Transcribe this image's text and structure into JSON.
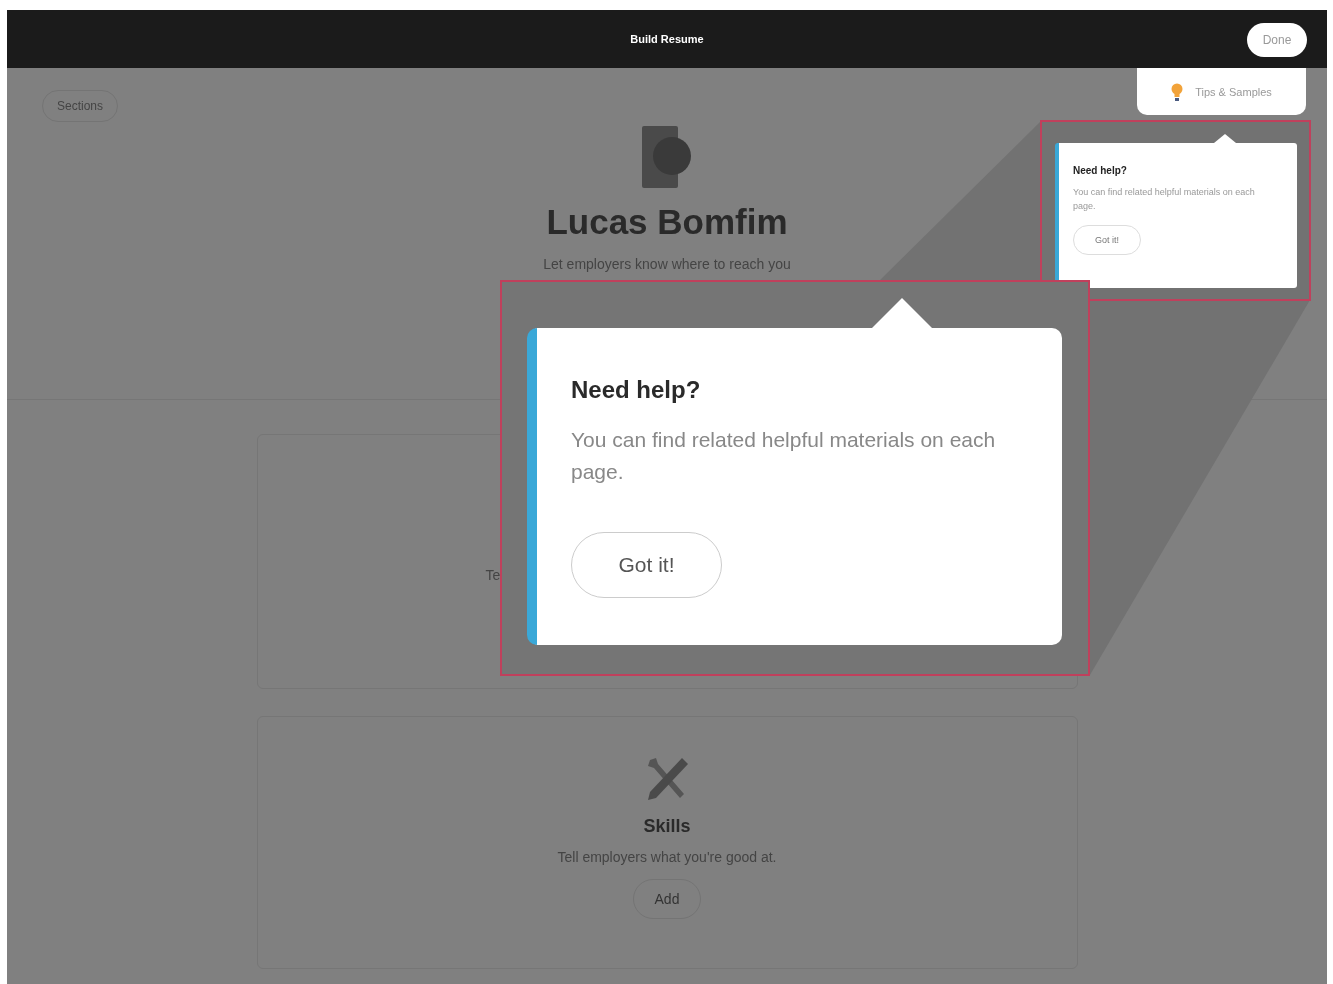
{
  "header": {
    "title": "Build Resume",
    "done_button": "Done"
  },
  "sections_button": "Sections",
  "profile": {
    "name": "Lucas Bomfim",
    "subtitle": "Let employers know where to reach you"
  },
  "cards": [
    {
      "description": "Te"
    },
    {
      "title": "Skills",
      "description": "Tell employers what you're good at.",
      "button": "Add"
    }
  ],
  "tips_tab": {
    "label": "Tips & Samples"
  },
  "help_popover": {
    "title": "Need help?",
    "text": "You can find related helpful materials on each page.",
    "button": "Got it!"
  },
  "help_popover_zoomed": {
    "title": "Need help?",
    "text": "You can find related helpful materials on each page.",
    "button": "Got it!"
  }
}
